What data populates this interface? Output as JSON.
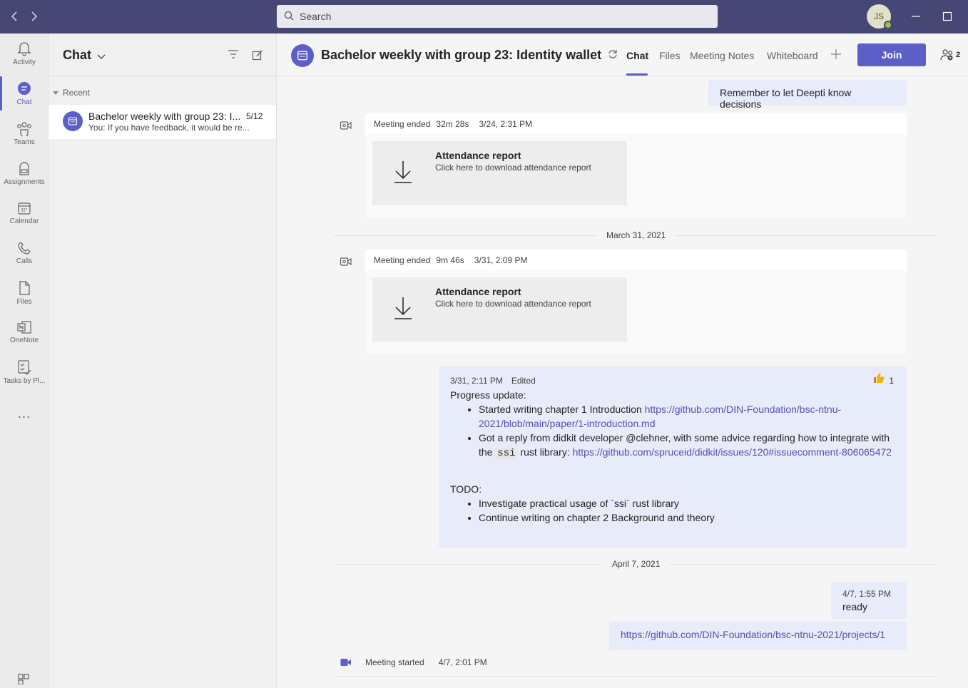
{
  "titlebar": {
    "search_placeholder": "Search",
    "avatar_initials": "JS"
  },
  "rail": {
    "items": [
      {
        "label": "Activity",
        "icon": "bell-icon"
      },
      {
        "label": "Chat",
        "icon": "chat-icon"
      },
      {
        "label": "Teams",
        "icon": "teams-icon"
      },
      {
        "label": "Assignments",
        "icon": "backpack-icon"
      },
      {
        "label": "Calendar",
        "icon": "calendar-icon"
      },
      {
        "label": "Calls",
        "icon": "phone-icon"
      },
      {
        "label": "Files",
        "icon": "file-icon"
      },
      {
        "label": "OneNote",
        "icon": "onenote-icon"
      },
      {
        "label": "Tasks by Pl...",
        "icon": "tasks-icon"
      }
    ],
    "more": "..."
  },
  "chatlist": {
    "title": "Chat",
    "section": "Recent",
    "items": [
      {
        "title": "Bachelor weekly with group 23: I...",
        "date": "5/12",
        "preview": "You: If you have feedback, it would be re..."
      }
    ]
  },
  "header": {
    "title": "Bachelor weekly with group 23: Identity wallet",
    "tabs": [
      "Chat",
      "Files",
      "Meeting Notes",
      "Whiteboard"
    ],
    "join_label": "Join",
    "participants_count": "2"
  },
  "messages": {
    "top_bubble": "Remember to let Deepti know decisions",
    "meeting1": {
      "status": "Meeting ended",
      "duration": "32m 28s",
      "time": "3/24, 2:31 PM",
      "report_title": "Attendance report",
      "report_sub": "Click here to download attendance report"
    },
    "date1": "March 31, 2021",
    "meeting2": {
      "status": "Meeting ended",
      "duration": "9m 46s",
      "time": "3/31, 2:09 PM",
      "report_title": "Attendance report",
      "report_sub": "Click here to download attendance report"
    },
    "progress": {
      "time": "3/31, 2:11 PM",
      "edited": "Edited",
      "reaction_count": "1",
      "heading": "Progress update:",
      "b1_text": "Started writing chapter 1 Introduction ",
      "b1_link": "https://github.com/DIN-Foundation/bsc-ntnu-2021/blob/main/paper/1-introduction.md",
      "b2_text_a": "Got a reply from didkit developer @clehner, with some advice regarding how to integrate with the ",
      "b2_code": "ssi",
      "b2_text_b": " rust library: ",
      "b2_link": "https://github.com/spruceid/didkit/issues/120#issuecomment-806065472",
      "todo": "TODO:",
      "t1": "Investigate practical usage of `ssi` rust library",
      "t2": "Continue writing on chapter 2 Background and theory"
    },
    "date2": "April 7, 2021",
    "ready": {
      "time": "4/7, 1:55 PM",
      "text": "ready"
    },
    "link_msg": "https://github.com/DIN-Foundation/bsc-ntnu-2021/projects/1",
    "meeting_started": {
      "status": "Meeting started",
      "time": "4/7, 2:01 PM"
    }
  }
}
